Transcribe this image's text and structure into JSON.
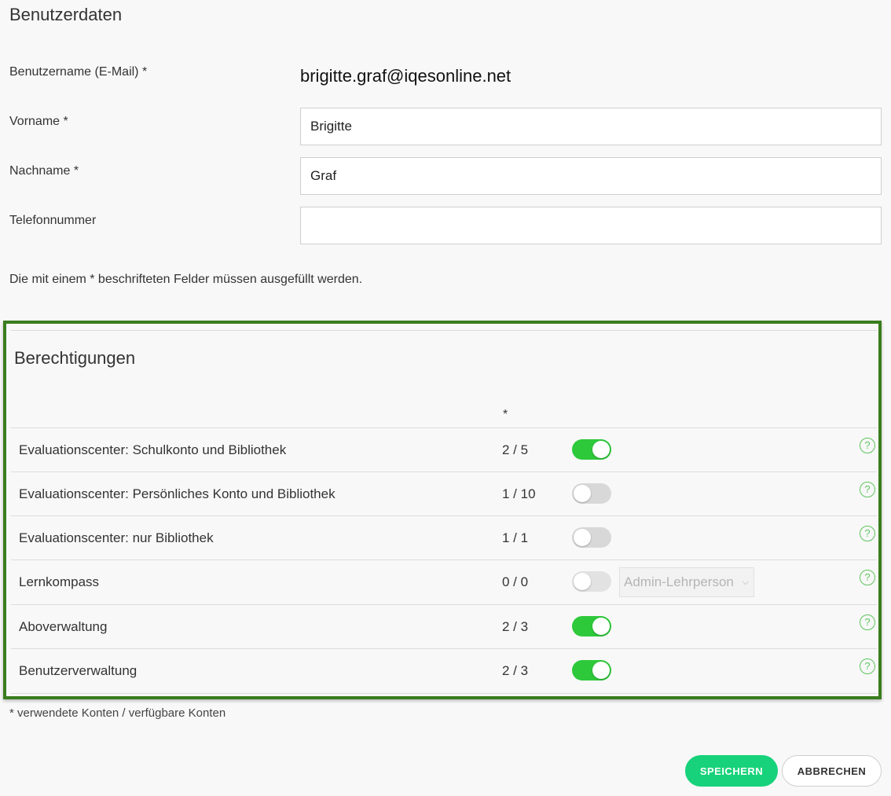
{
  "user_section": {
    "title": "Benutzerdaten",
    "username_label": "Benutzername (E-Mail) *",
    "username_value": "brigitte.graf@iqesonline.net",
    "firstname_label": "Vorname *",
    "firstname_value": "Brigitte",
    "lastname_label": "Nachname *",
    "lastname_value": "Graf",
    "phone_label": "Telefonnummer",
    "phone_value": "",
    "required_hint": "Die mit einem * beschrifteten Felder müssen ausgefüllt werden."
  },
  "permissions": {
    "title": "Berechtigungen",
    "count_column_header": "*",
    "rows": [
      {
        "name": "Evaluationscenter: Schulkonto und Bibliothek",
        "count": "2 / 5",
        "enabled": true
      },
      {
        "name": "Evaluationscenter: Persönliches Konto und Bibliothek",
        "count": "1 / 10",
        "enabled": false
      },
      {
        "name": "Evaluationscenter: nur Bibliothek",
        "count": "1 / 1",
        "enabled": false
      },
      {
        "name": "Lernkompass",
        "count": "0 / 0",
        "enabled": false,
        "role_select": "Admin-Lehrperson"
      },
      {
        "name": "Aboverwaltung",
        "count": "2 / 3",
        "enabled": true
      },
      {
        "name": "Benutzerverwaltung",
        "count": "2 / 3",
        "enabled": true
      }
    ],
    "help_glyph": "?",
    "highlight_color": "#3a7d1e",
    "toggle_on_color": "#2ec93b"
  },
  "footnote": "* verwendete Konten / verfügbare Konten",
  "actions": {
    "save_label": "SPEICHERN",
    "cancel_label": "ABBRECHEN"
  },
  "icons": {
    "help": "help-circle-icon",
    "select_chevron": "chevron-down-icon"
  }
}
